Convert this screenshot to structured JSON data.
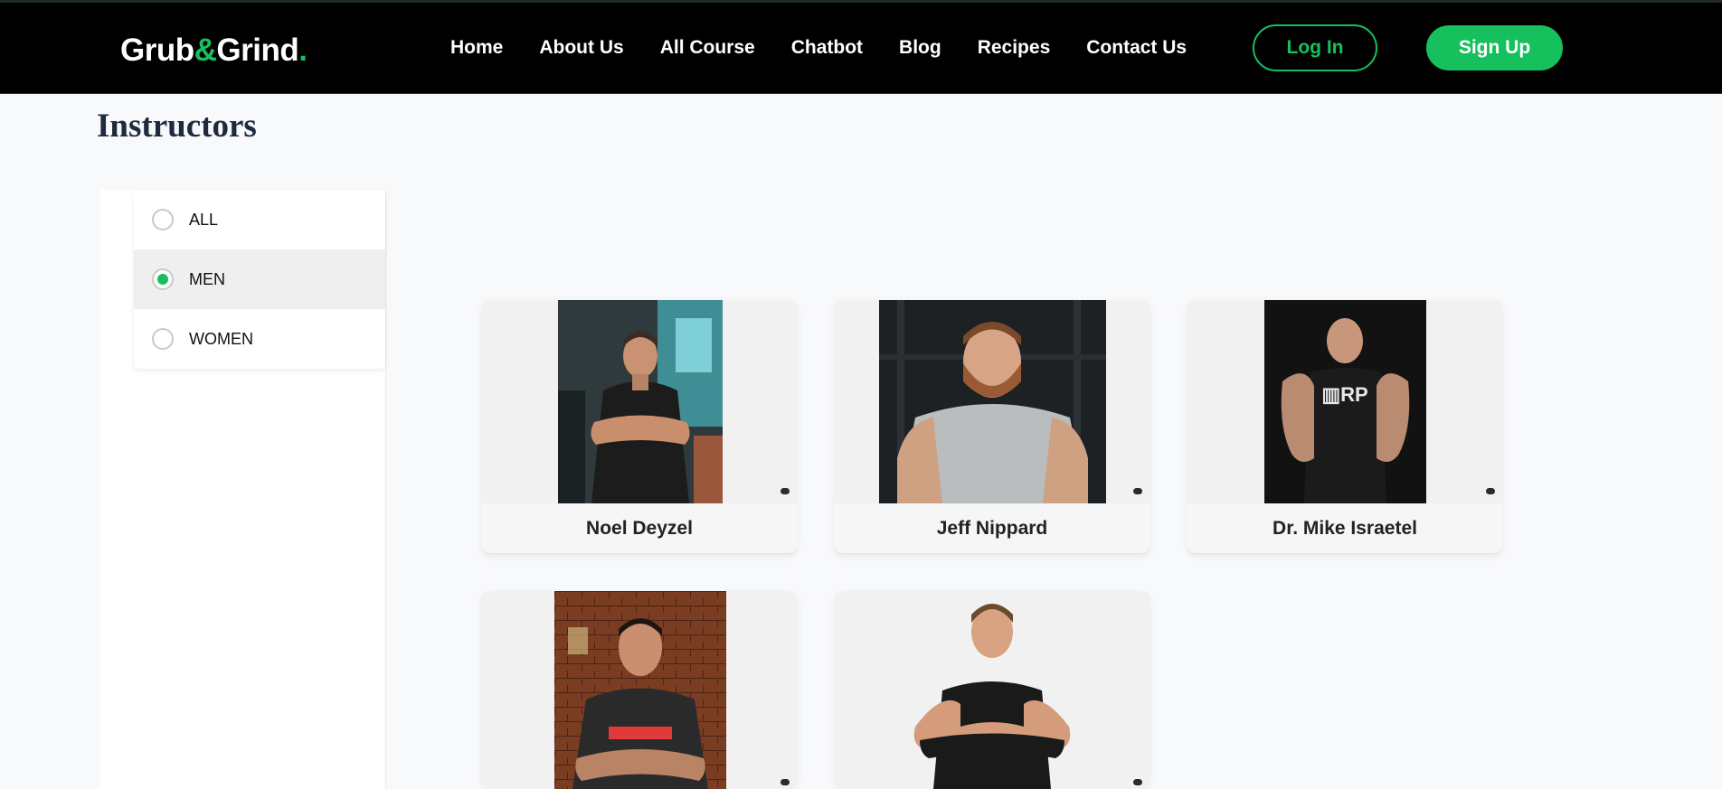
{
  "header": {
    "logo": {
      "part1": "Grub",
      "amp": "&",
      "part2": "Grind",
      "dot": "."
    },
    "nav": [
      "Home",
      "About Us",
      "All Course",
      "Chatbot",
      "Blog",
      "Recipes",
      "Contact Us"
    ],
    "login_label": "Log In",
    "signup_label": "Sign Up"
  },
  "page": {
    "title": "Instructors"
  },
  "filters": [
    {
      "label": "ALL",
      "selected": false
    },
    {
      "label": "MEN",
      "selected": true
    },
    {
      "label": "WOMEN",
      "selected": false
    }
  ],
  "instructors": [
    {
      "name": "Noel Deyzel"
    },
    {
      "name": "Jeff Nippard"
    },
    {
      "name": "Dr. Mike Israetel"
    },
    {
      "name": ""
    },
    {
      "name": ""
    }
  ],
  "colors": {
    "accent": "#16c15d",
    "navbar": "#000000",
    "page_bg": "#f8f9fb"
  }
}
